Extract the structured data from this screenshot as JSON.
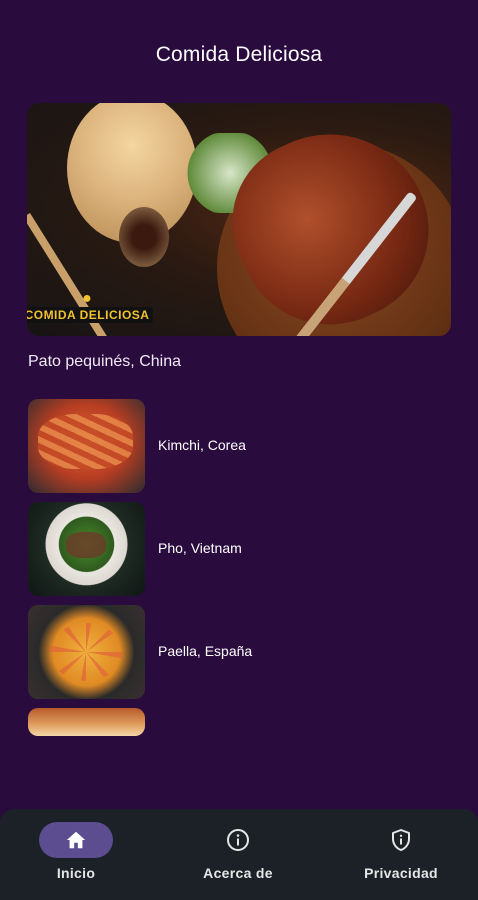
{
  "app": {
    "title": "Comida Deliciosa"
  },
  "hero": {
    "logo_text": "COMIDA DELICIOSA",
    "caption": "Pato pequinés, China"
  },
  "dishes": [
    {
      "label": "Kimchi, Corea"
    },
    {
      "label": "Pho, Vietnam"
    },
    {
      "label": "Paella, España"
    }
  ],
  "nav": {
    "items": [
      {
        "label": "Inicio",
        "icon": "home-icon",
        "active": true
      },
      {
        "label": "Acerca de",
        "icon": "info-icon",
        "active": false
      },
      {
        "label": "Privacidad",
        "icon": "shield-info-icon",
        "active": false
      }
    ]
  },
  "colors": {
    "background": "#2a0b3e",
    "nav_background": "#1b2126",
    "active_pill": "#5b4d8f",
    "logo_accent": "#f2c230"
  }
}
